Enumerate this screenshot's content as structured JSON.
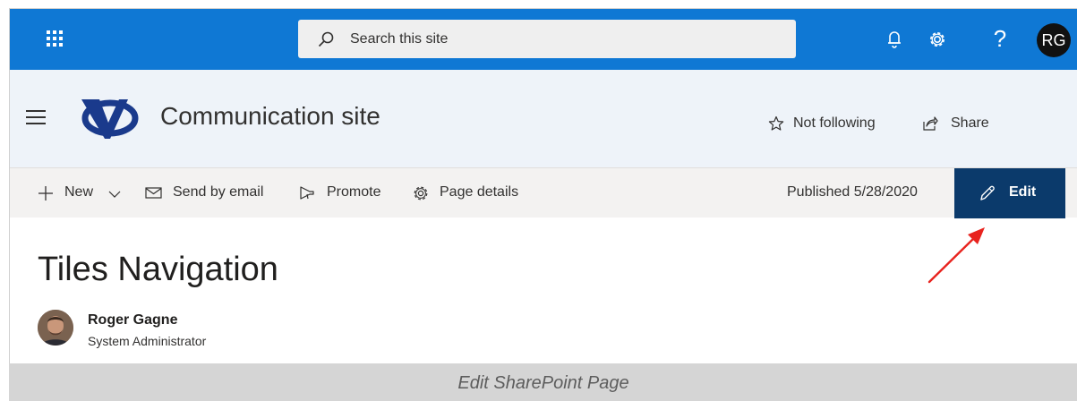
{
  "suitebar": {
    "search_placeholder": "Search this site",
    "avatar_initials": "RG",
    "help_glyph": "?",
    "brand_color": "#0f78d4",
    "icons": [
      "app-launcher-icon",
      "search-icon",
      "bell-icon",
      "gear-icon",
      "help-icon"
    ]
  },
  "site": {
    "title": "Communication site",
    "follow_label": "Not following",
    "share_label": "Share",
    "header_bg": "#eef3f9"
  },
  "commandbar": {
    "new_label": "New",
    "send_email_label": "Send by email",
    "promote_label": "Promote",
    "page_details_label": "Page details",
    "published_text": "Published 5/28/2020",
    "edit_label": "Edit",
    "edit_bg": "#0b3a6b"
  },
  "page": {
    "title": "Tiles Navigation",
    "author_name": "Roger Gagne",
    "author_role": "System Administrator"
  },
  "annotation": {
    "arrow_color": "#e8231e"
  },
  "caption": {
    "text": "Edit SharePoint Page"
  }
}
